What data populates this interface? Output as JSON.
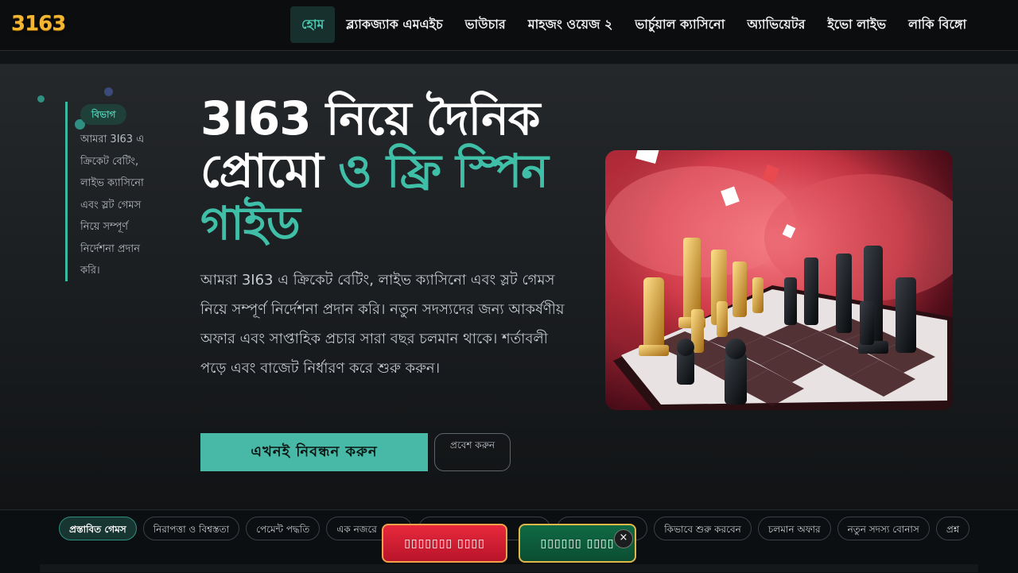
{
  "logo": {
    "text": "3163"
  },
  "nav": {
    "items": [
      {
        "label": "হোম",
        "active": true
      },
      {
        "label": "ব্ল্যাকজ্যাক এমএইচ"
      },
      {
        "label": "ভাউচার"
      },
      {
        "label": "মাহজং ওয়েজ ২"
      },
      {
        "label": "ভার্চুয়াল ক্যাসিনো"
      },
      {
        "label": "অ্যাভিয়েটর"
      },
      {
        "label": "ইভো লাইভ"
      },
      {
        "label": "লাকি বিঙ্গো"
      }
    ]
  },
  "sidebar": {
    "badge": "বিভাগ",
    "text": "আমরা 3I63 এ ক্রিকেট বেটিং, লাইভ ক্যাসিনো এবং স্লট গেমস নিয়ে সম্পূর্ণ নির্দেশনা প্রদান করি।"
  },
  "hero": {
    "title_main": "3I63 নিয়ে দৈনিক প্রোমো ",
    "title_accent": "ও ফ্রি স্পিন গাইড",
    "description": "আমরা 3I63 এ ক্রিকেট বেটিং, লাইভ ক্যাসিনো এবং স্লট গেমস নিয়ে সম্পূর্ণ নির্দেশনা প্রদান করি। নতুন সদস্যদের জন্য আকর্ষণীয় অফার এবং সাপ্তাহিক প্রচার সারা বছর চলমান থাকে। শর্তাবলী পড়ে এবং বাজেট নির্ধারণ করে শুরু করুন।",
    "cta_label": "এখনই নিবন্ধন করুন",
    "login_label": "প্রবেশ করুন"
  },
  "tabs": [
    {
      "label": "প্রস্তাবিত গেমস",
      "active": true
    },
    {
      "label": "নিরাপত্তা ও বিশ্বস্ততা"
    },
    {
      "label": "পেমেন্ট পদ্ধতি"
    },
    {
      "label": "এক নজরে"
    },
    {
      "label": ""
    },
    {
      "label": ""
    },
    {
      "label": "কিভাবে শুরু করবেন"
    },
    {
      "label": "চলমান অফার"
    },
    {
      "label": "নতুন সদস্য বোনাস"
    },
    {
      "label": "প্রশ্ন"
    }
  ],
  "floating": {
    "left_label": "▯▯▯▯▯▯▯ ▯▯▯▯",
    "right_label": "▯▯▯▯▯▯ ▯▯▯▯",
    "close_symbol": "×"
  }
}
